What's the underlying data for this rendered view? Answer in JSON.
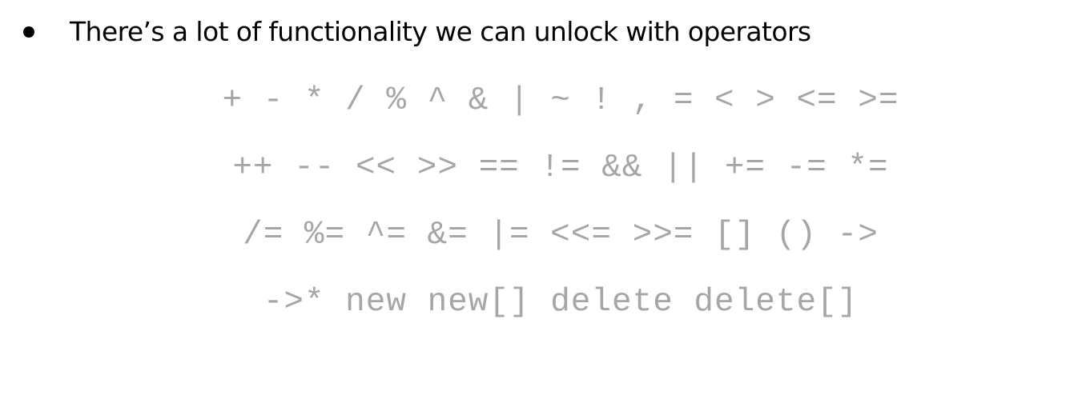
{
  "bullet": {
    "text": "There’s a lot of functionality we can unlock with operators"
  },
  "operators": {
    "lines": [
      "+ - * / % ^ & | ~ ! , = < > <= >=",
      "++ -- << >> == != && || += -= *=",
      "/= %= ^= &= |= <<= >>= [] () ->",
      "->* new new[] delete delete[]"
    ]
  },
  "colors": {
    "text": "#000000",
    "operators": "#a6a6a6"
  }
}
